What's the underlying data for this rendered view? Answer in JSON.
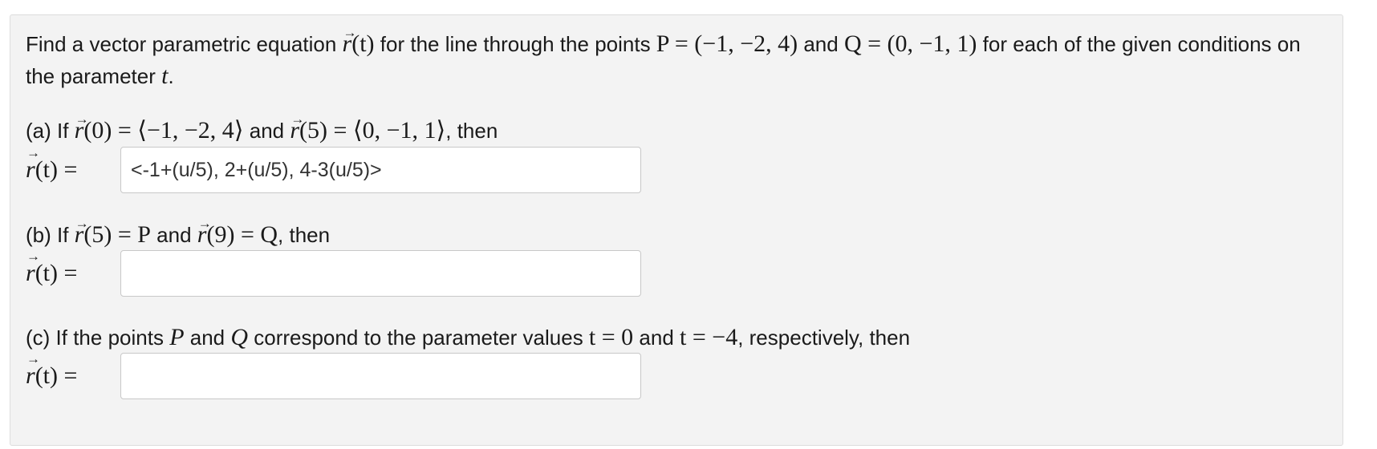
{
  "intro": {
    "t1": "Find a vector parametric equation ",
    "r": "r",
    "t_arg": "(t)",
    "t2": " for the line through the points ",
    "p_def": "P = (−1, −2, 4)",
    "t3": " and ",
    "q_def": "Q = (0, −1, 1)",
    "t4": " for each of the given conditions on the parameter ",
    "t_var": "t",
    "t5": "."
  },
  "parts": [
    {
      "label_pre": "(a) If ",
      "r1": "r",
      "c1": "(0) = ⟨−1, −2, 4⟩",
      "mid": " and ",
      "r2": "r",
      "c2": "(5) = ⟨0, −1, 1⟩",
      "post": ", then",
      "lhs_r": "r",
      "lhs_rest": "(t) =",
      "value": "<-1+(u/5), 2+(u/5), 4-3(u/5)>"
    },
    {
      "label_pre": "(b) If ",
      "r1": "r",
      "c1": "(5) = P",
      "mid": " and ",
      "r2": "r",
      "c2": "(9) = Q",
      "post": ", then",
      "lhs_r": "r",
      "lhs_rest": "(t) =",
      "value": ""
    },
    {
      "label_a": "(c) If the points ",
      "p": "P",
      "label_b": " and ",
      "q": "Q",
      "label_c": " correspond to the parameter values ",
      "cond1": "t = 0",
      "label_d": " and ",
      "cond2": "t = −4",
      "label_e": ", respectively, then",
      "lhs_r": "r",
      "lhs_rest": "(t) =",
      "value": ""
    }
  ]
}
